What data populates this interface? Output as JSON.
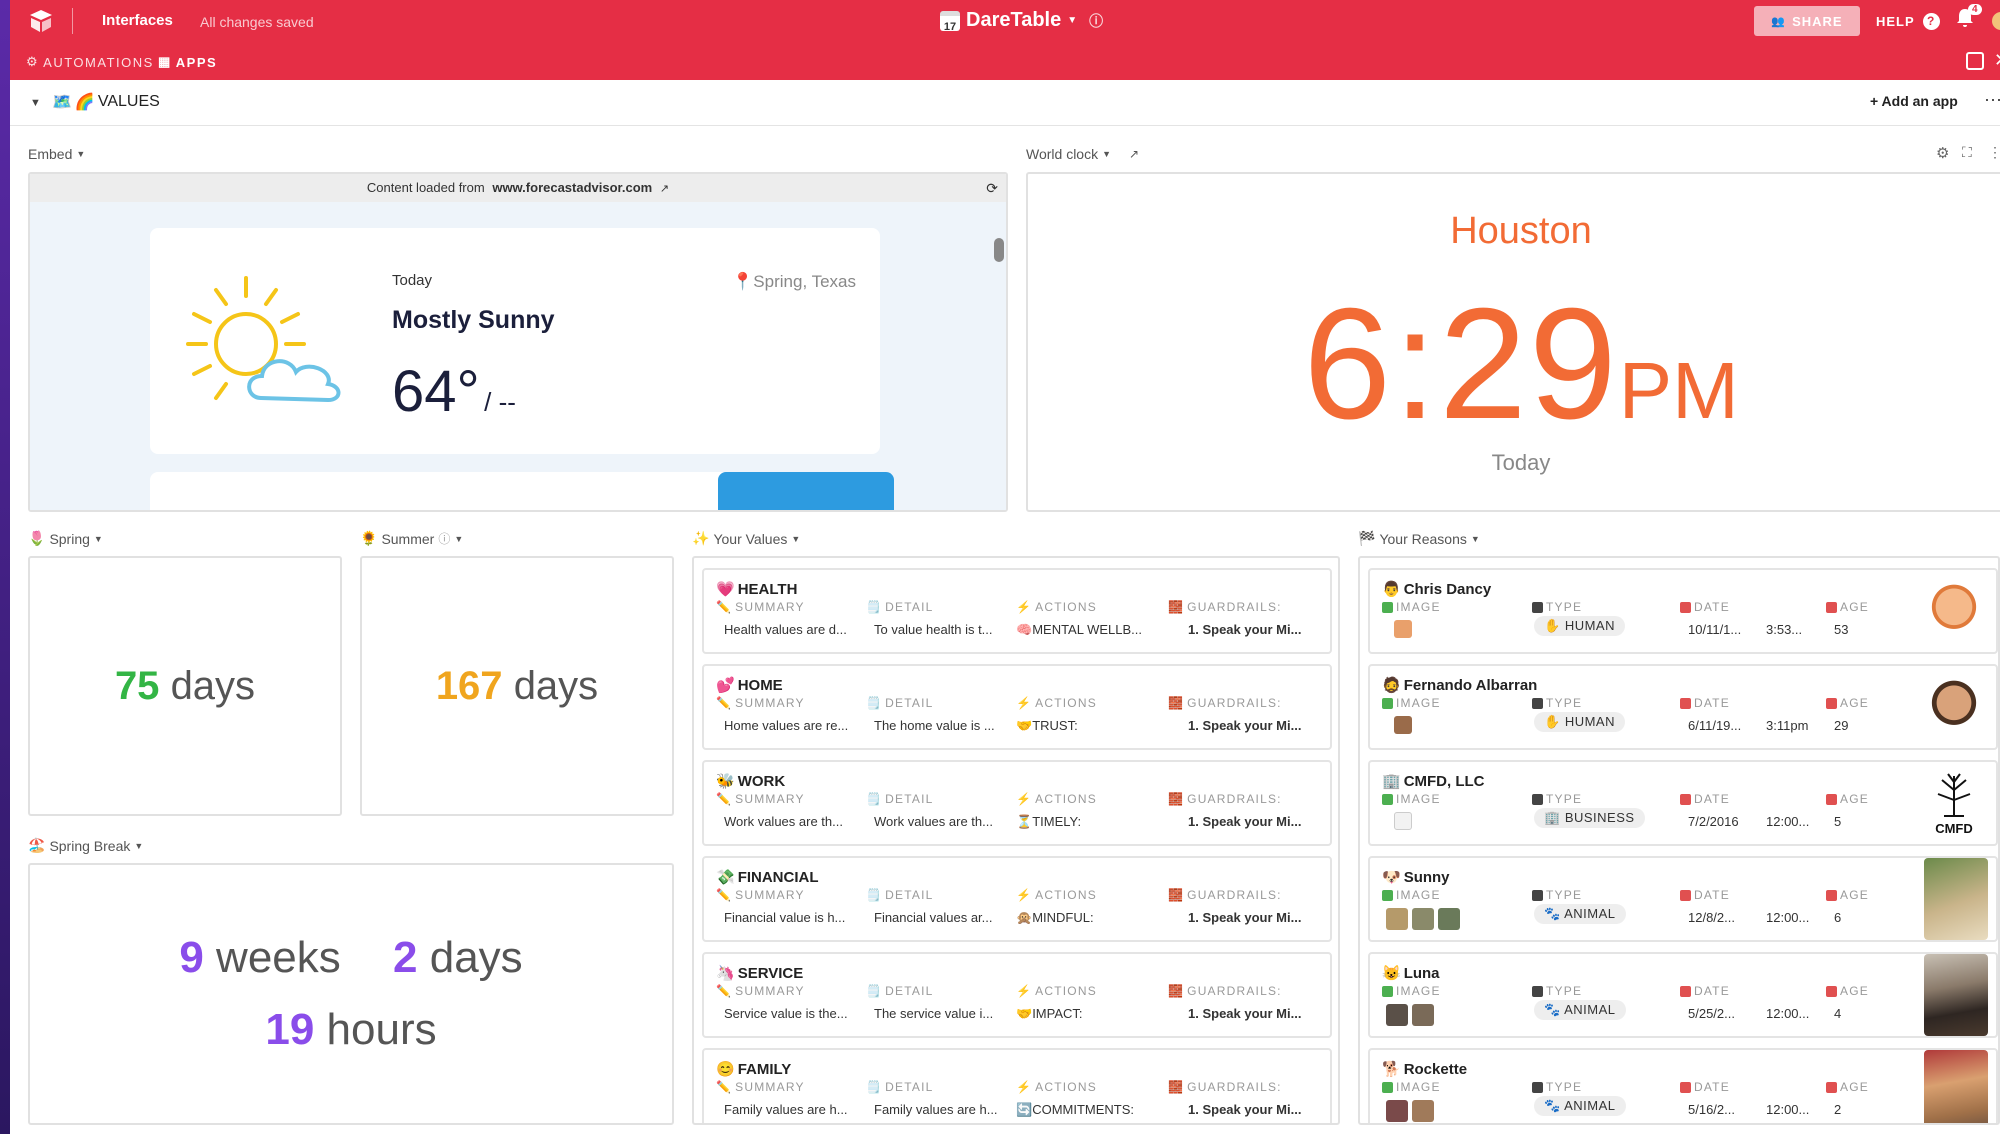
{
  "topbar": {
    "interfaces": "Interfaces",
    "saved": "All changes saved",
    "app_title": "DareTable",
    "calendar_day": "17",
    "share": "SHARE",
    "help": "HELP",
    "notifications": "4",
    "automations": "AUTOMATIONS",
    "apps": "APPS",
    "accent": "#e52e45"
  },
  "section": {
    "name": "VALUES",
    "add_app": "Add an app"
  },
  "embed": {
    "label": "Embed",
    "source_prefix": "Content loaded from",
    "source_domain": "www.forecastadvisor.com",
    "day": "Today",
    "location": "Spring, Texas",
    "condition": "Mostly Sunny",
    "temp": "64°",
    "temp_low": "/ --"
  },
  "clock": {
    "label": "World clock",
    "city": "Houston",
    "time": "6:29",
    "ampm": "PM",
    "day": "Today",
    "color": "#f26b35"
  },
  "countdowns": {
    "spring": {
      "label": "Spring",
      "value": "75",
      "unit": "days",
      "color": "#33b545"
    },
    "summer": {
      "label": "Summer",
      "value": "167",
      "unit": "days",
      "color": "#f0a51e"
    },
    "spring_break": {
      "label": "Spring Break",
      "weeks": "9",
      "weeks_unit": "weeks",
      "days": "2",
      "days_unit": "days",
      "hours": "19",
      "hours_unit": "hours",
      "color": "#8a4dea"
    }
  },
  "values": {
    "label": "Your Values",
    "field_labels": {
      "summary": "SUMMARY",
      "detail": "DETAIL",
      "actions": "ACTIONS",
      "guardrails": "GUARDRAILS:"
    },
    "records": [
      {
        "title": "HEALTH",
        "summary": "Health values are d...",
        "detail": "To value health is t...",
        "actions": "MENTAL WELLB...",
        "guardrails": "1.  Speak your Mi..."
      },
      {
        "title": "HOME",
        "summary": "Home values are re...",
        "detail": "The home value is ...",
        "actions": "TRUST:",
        "guardrails": "1.  Speak your Mi..."
      },
      {
        "title": "WORK",
        "summary": "Work values are th...",
        "detail": "Work values are th...",
        "actions": "TIMELY:",
        "guardrails": "1.  Speak your Mi..."
      },
      {
        "title": "FINANCIAL",
        "summary": "Financial value is h...",
        "detail": "Financial values ar...",
        "actions": "MINDFUL:",
        "guardrails": "1.  Speak your Mi..."
      },
      {
        "title": "SERVICE",
        "summary": "Service value is the...",
        "detail": "The service value i...",
        "actions": "IMPACT:",
        "guardrails": "1.  Speak your Mi..."
      },
      {
        "title": "FAMILY",
        "summary": "Family values are h...",
        "detail": "Family values are h...",
        "actions": "COMMITMENTS:",
        "guardrails": "1.  Speak your Mi..."
      }
    ]
  },
  "reasons": {
    "label": "Your Reasons",
    "field_labels": {
      "image": "IMAGE",
      "type": "TYPE",
      "date": "DATE",
      "age": "AGE"
    },
    "records": [
      {
        "name": "Chris Dancy",
        "type": "HUMAN",
        "date": "10/11/1...",
        "time": "3:53...",
        "age": "53"
      },
      {
        "name": "Fernando Albarran",
        "type": "HUMAN",
        "date": "6/11/19...",
        "time": "3:11pm",
        "age": "29"
      },
      {
        "name": "CMFD, LLC",
        "type": "BUSINESS",
        "date": "7/2/2016",
        "time": "12:00...",
        "age": "5",
        "logo_text": "CMFD"
      },
      {
        "name": "Sunny",
        "type": "ANIMAL",
        "date": "12/8/2...",
        "time": "12:00...",
        "age": "6"
      },
      {
        "name": "Luna",
        "type": "ANIMAL",
        "date": "5/25/2...",
        "time": "12:00...",
        "age": "4"
      },
      {
        "name": "Rockette",
        "type": "ANIMAL",
        "date": "5/16/2...",
        "time": "12:00...",
        "age": "2"
      }
    ]
  }
}
